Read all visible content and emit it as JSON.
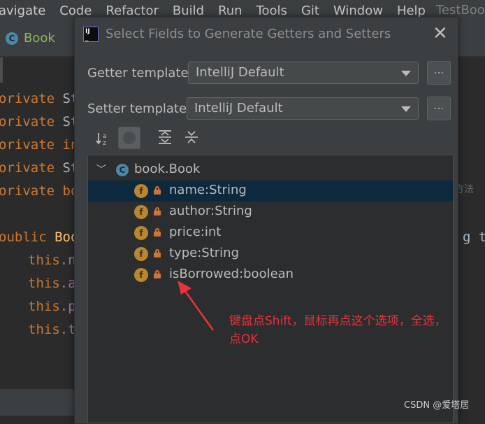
{
  "menubar": {
    "items": [
      "avigate",
      "Code",
      "Refactor",
      "Build",
      "Run",
      "Tools",
      "Git",
      "Window",
      "Help"
    ],
    "window_title": "TestBoo"
  },
  "editor_tab": {
    "label": "Book",
    "icon": "class-icon"
  },
  "editor": {
    "lines": [
      {
        "kw": "orivate",
        "rest": " St"
      },
      {
        "kw": "orivate",
        "rest": " St"
      },
      {
        "kw": "orivate",
        "rest": " in"
      },
      {
        "kw": "orivate",
        "rest": " St"
      },
      {
        "kw": "orivate",
        "rest": " bo"
      },
      {
        "kw": "oublic",
        "rest": " Boo"
      },
      {
        "kw": "this",
        "rest": ".n"
      },
      {
        "kw": "this",
        "rest": ".a"
      },
      {
        "kw": "this",
        "rest": ".p"
      },
      {
        "kw": "this",
        "rest": ".t"
      }
    ],
    "right_text": "g t",
    "hint": "方法"
  },
  "dialog": {
    "title": "Select Fields to Generate Getters and Setters",
    "getter_label": "Getter template:",
    "getter_value": "IntelliJ Default",
    "setter_label": "Setter template:",
    "setter_value": "IntelliJ Default",
    "dots": "...",
    "sort_icon_text": "↓a z",
    "tree": {
      "root": "book.Book",
      "fields": [
        {
          "label": "name:String",
          "selected": true
        },
        {
          "label": "author:String",
          "selected": false
        },
        {
          "label": "price:int",
          "selected": false
        },
        {
          "label": "type:String",
          "selected": false
        },
        {
          "label": "isBorrowed:boolean",
          "selected": false
        }
      ]
    }
  },
  "annotation": {
    "line1": "键盘点Shift，鼠标再点这个选项，全选，",
    "line2": "点OK"
  },
  "watermark": "CSDN @爱塔居"
}
